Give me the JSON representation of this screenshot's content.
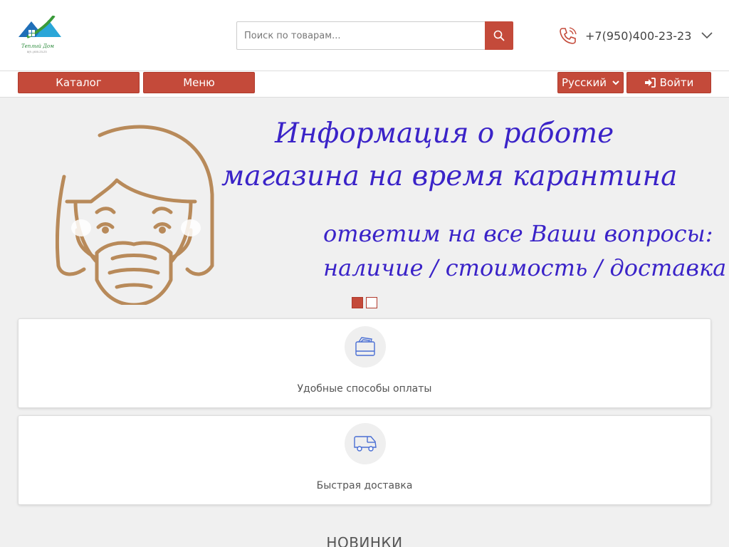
{
  "header": {
    "logo_text": "Теплый Дом",
    "logo_sub": "8(9..)400-23-23",
    "search_placeholder": "Поиск по товарам...",
    "phone": "+7(950)400-23-23"
  },
  "menubar": {
    "catalog_label": "Каталог",
    "menu_label": "Меню",
    "language_label": "Русский",
    "login_label": "Войти"
  },
  "banner": {
    "title_line1": "Информация о работе",
    "title_line2": "магазина на время карантина",
    "subtitle_line1": "ответим на все Ваши вопросы:",
    "subtitle_line2": "наличие / стоимость / доставка",
    "slide_count": 2,
    "active_slide": 1
  },
  "features": [
    {
      "label": "Удобные способы оплаты",
      "icon": "wallet-icon"
    },
    {
      "label": "Быстрая доставка",
      "icon": "truck-icon"
    }
  ],
  "sections": {
    "new_items_title": "НОВИНКИ"
  },
  "colors": {
    "accent": "#c44a3a",
    "banner_text": "#3a23c8",
    "illustration": "#b88a5a",
    "icon_blue": "#4a6fd4"
  }
}
